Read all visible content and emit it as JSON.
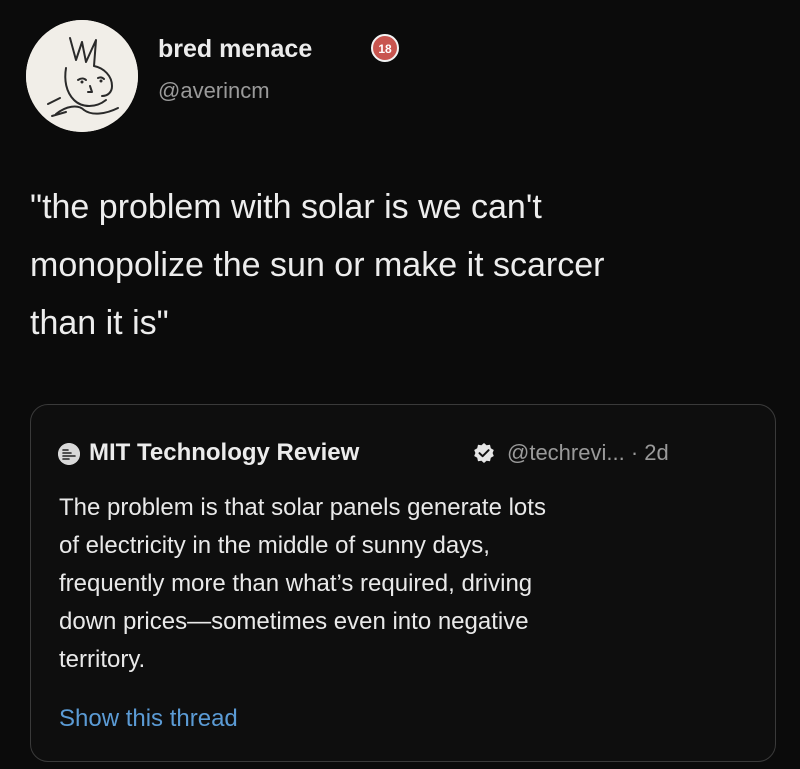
{
  "author": {
    "display_name": "bred menace",
    "badge_text": "18",
    "handle": "@averincm"
  },
  "tweet": {
    "text": "\"the problem with solar is we can't\nmonopolize the sun or make it scarcer\nthan it is\""
  },
  "quoted_tweet": {
    "author_name": "MIT Technology Review",
    "handle_time": "@techrevi... · 2d",
    "text": "The problem is that solar panels generate lots\nof electricity in the middle of sunny days,\nfrequently more than what’s required, driving\ndown prices—sometimes even into negative\nterritory.",
    "show_thread_label": "Show this thread"
  },
  "colors": {
    "background": "#0b0b0b",
    "link": "#5b9bd5",
    "badge": "#c8554f"
  }
}
